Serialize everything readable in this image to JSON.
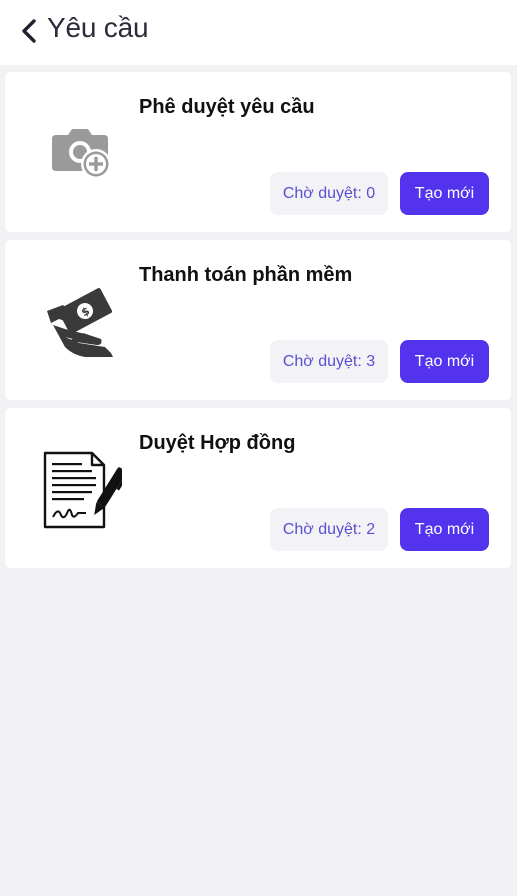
{
  "header": {
    "title": "Yêu cầu",
    "back_icon": "chevron-left-icon"
  },
  "colors": {
    "accent": "#5333ed",
    "pending_text": "#5a4fcf",
    "pending_bg": "#f3f3f7",
    "background": "#f2f2f4"
  },
  "cards": [
    {
      "title": "Phê duyệt yêu cầu",
      "icon": "camera-add-icon",
      "pending_label": "Chờ duyệt: 0",
      "create_label": "Tạo mới"
    },
    {
      "title": "Thanh toán phần mềm",
      "icon": "money-payment-icon",
      "pending_label": "Chờ duyệt: 3",
      "create_label": "Tạo mới"
    },
    {
      "title": "Duyệt Hợp đồng",
      "icon": "contract-sign-icon",
      "pending_label": "Chờ duyệt: 2",
      "create_label": "Tạo mới"
    }
  ]
}
